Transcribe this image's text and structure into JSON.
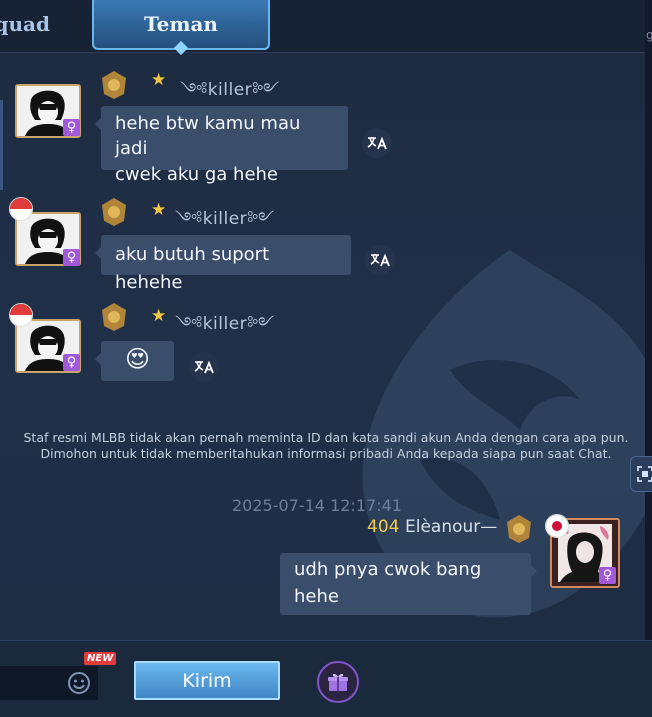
{
  "tabs": {
    "squad_label": "Squad",
    "teman_label": "Teman",
    "active": "Teman"
  },
  "edge_text": "g",
  "messages": [
    {
      "username": "༺killer༻",
      "text_lines": [
        "hehe btw kamu mau jadi",
        "cwek aku ga hehe"
      ],
      "gender": "♀",
      "has_flag": true
    },
    {
      "username": "༺killer༻",
      "text_lines": [
        "aku butuh suport hehehe"
      ],
      "gender": "♀",
      "has_flag": true
    },
    {
      "username": "༺killer༻",
      "emoji": "😍",
      "gender": "♀",
      "has_flag": true
    }
  ],
  "notice": "Staf resmi MLBB tidak akan pernah meminta ID dan kata sandi akun Anda dengan cara apa pun. Dimohon untuk tidak memberitahukan informasi pribadi Anda kepada siapa pun saat Chat.",
  "own_message": {
    "timestamp": "2025-07-14 12:17:41",
    "level": "404",
    "name": "Elèanour—",
    "text_lines": [
      "udh pnya cwok bang",
      "hehe"
    ],
    "gender": "♀"
  },
  "bottom": {
    "input_value": "",
    "new_badge": "NEW",
    "send_label": "Kirim"
  },
  "colors": {
    "background": "#1d2b40",
    "bubble": "#3a4d6b",
    "accent": "#6bb8ee",
    "star": "#f5c542",
    "level": "#f2c94c",
    "gender_badge": "#a259d9"
  },
  "icons": {
    "translate": "translate-icon",
    "emoji": "smiley-icon",
    "gift": "gift-icon",
    "flag": "indonesia-flag-icon",
    "rank": "rank-emblem-icon",
    "screenshot": "capture-icon"
  }
}
